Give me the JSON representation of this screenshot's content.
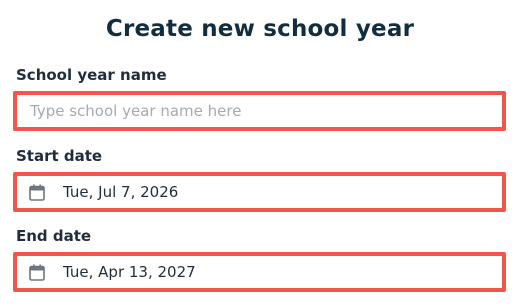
{
  "form": {
    "title": "Create new school year",
    "name_field": {
      "label": "School year name",
      "value": "",
      "placeholder": "Type school year name here"
    },
    "start_field": {
      "label": "Start date",
      "value": "Tue, Jul 7, 2026",
      "icon": "calendar-icon"
    },
    "end_field": {
      "label": "End date",
      "value": "Tue, Apr 13, 2027",
      "icon": "calendar-icon"
    }
  },
  "colors": {
    "title": "#122d40",
    "text": "#1f2d3d",
    "placeholder": "#a3abb4",
    "focus_border": "#f0564a",
    "icon": "#6b7681"
  }
}
